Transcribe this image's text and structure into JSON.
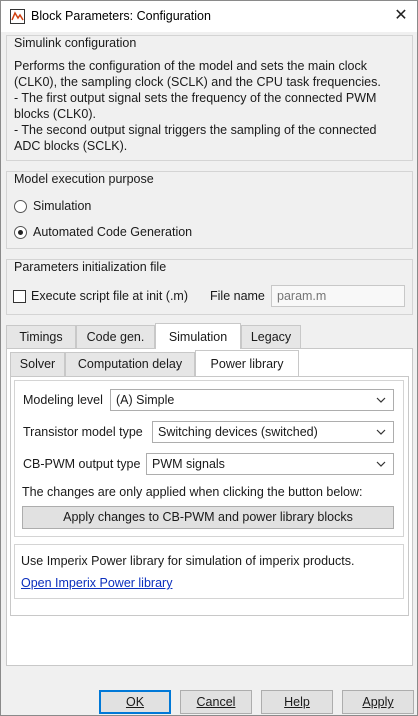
{
  "window": {
    "title": "Block Parameters: Configuration",
    "close_glyph": "✕",
    "icon": "simulink-block-icon"
  },
  "config_group": {
    "title": "Simulink configuration",
    "lines": [
      "Performs the configuration of the model and sets the main clock",
      "(CLK0), the sampling clock (SCLK) and the CPU task frequencies.",
      "- The first output signal sets the frequency of the connected PWM",
      "blocks (CLK0).",
      "- The second output signal triggers the sampling of the connected",
      "ADC blocks (SCLK)."
    ]
  },
  "purpose_group": {
    "title": "Model execution purpose",
    "options": [
      {
        "label": "Simulation",
        "checked": false
      },
      {
        "label": "Automated Code Generation",
        "checked": true
      }
    ]
  },
  "init_group": {
    "title": "Parameters initialization file",
    "checkbox_label": "Execute script file at init (.m)",
    "checkbox_checked": false,
    "file_label": "File name",
    "file_placeholder": "param.m"
  },
  "main_tabs": [
    {
      "label": "Timings",
      "active": false
    },
    {
      "label": "Code gen.",
      "active": false
    },
    {
      "label": "Simulation",
      "active": true
    },
    {
      "label": "Legacy",
      "active": false
    }
  ],
  "sub_tabs": [
    {
      "label": "Solver",
      "active": false
    },
    {
      "label": "Computation delay",
      "active": false
    },
    {
      "label": "Power library",
      "active": true
    }
  ],
  "power_library": {
    "modeling_level": {
      "label": "Modeling level",
      "value": "(A) Simple"
    },
    "transistor_model": {
      "label": "Transistor model type",
      "value": "Switching devices (switched)"
    },
    "cb_pwm_output": {
      "label": "CB-PWM output type",
      "value": "PWM signals"
    },
    "note": "The changes are only applied when clicking the button below:",
    "apply_button": "Apply changes to CB-PWM and power library blocks"
  },
  "imperix_info": {
    "text": "Use Imperix Power library for simulation of imperix products.",
    "link": "Open Imperix Power library"
  },
  "footer_buttons": {
    "ok": "OK",
    "cancel": "Cancel",
    "help": "Help",
    "apply": "Apply"
  }
}
